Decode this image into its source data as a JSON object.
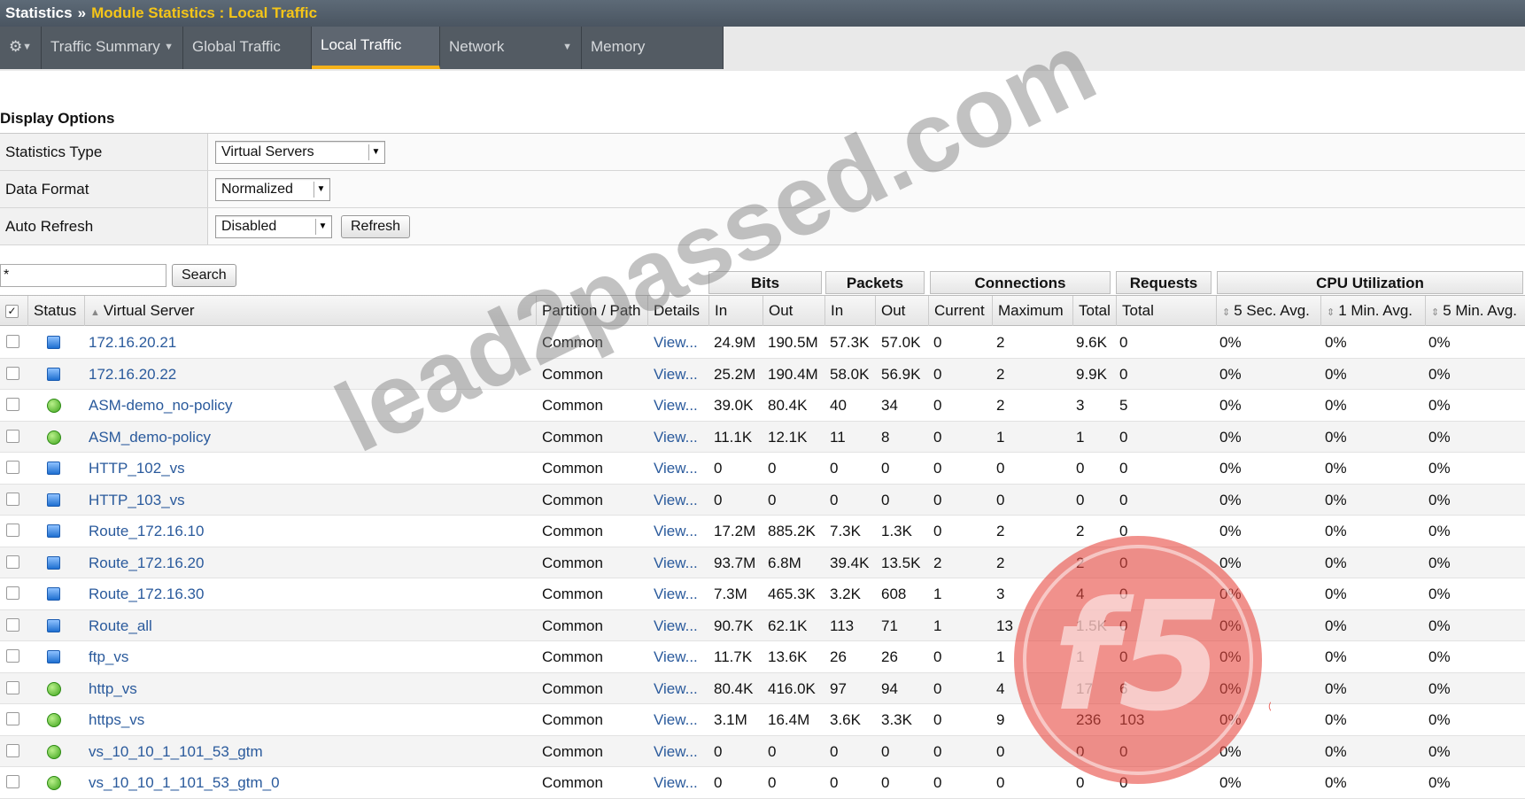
{
  "breadcrumb": {
    "root": "Statistics",
    "separator": "»",
    "current": "Module Statistics : Local Traffic"
  },
  "tabs": [
    {
      "label": "⚙",
      "has_menu": true
    },
    {
      "label": "Traffic Summary",
      "has_menu": true
    },
    {
      "label": "Global Traffic",
      "has_menu": false
    },
    {
      "label": "Local Traffic",
      "has_menu": false,
      "active": true
    },
    {
      "label": "Network",
      "has_menu": true
    },
    {
      "label": "Memory",
      "has_menu": false
    }
  ],
  "display_options": {
    "title": "Display Options",
    "statistics_type": {
      "label": "Statistics Type",
      "value": "Virtual Servers"
    },
    "data_format": {
      "label": "Data Format",
      "value": "Normalized"
    },
    "auto_refresh": {
      "label": "Auto Refresh",
      "value": "Disabled",
      "button": "Refresh"
    }
  },
  "search": {
    "value": "*",
    "button": "Search"
  },
  "groups": {
    "bits": "Bits",
    "packets": "Packets",
    "connections": "Connections",
    "requests": "Requests",
    "cpu": "CPU Utilization"
  },
  "columns": {
    "status": "Status",
    "virtual_server": "Virtual Server",
    "partition": "Partition / Path",
    "details": "Details",
    "bits_in": "In",
    "bits_out": "Out",
    "pkts_in": "In",
    "pkts_out": "Out",
    "conn_current": "Current",
    "conn_max": "Maximum",
    "conn_total": "Total",
    "req_total": "Total",
    "cpu_5s": "5 Sec. Avg.",
    "cpu_1m": "1 Min. Avg.",
    "cpu_5m": "5 Min. Avg."
  },
  "rows": [
    {
      "status": "blue",
      "name": "172.16.20.21",
      "partition": "Common",
      "details": "View...",
      "bits_in": "24.9M",
      "bits_out": "190.5M",
      "pkts_in": "57.3K",
      "pkts_out": "57.0K",
      "cur": "0",
      "max": "2",
      "total": "9.6K",
      "req": "0",
      "c5s": "0%",
      "c1m": "0%",
      "c5m": "0%"
    },
    {
      "status": "blue",
      "name": "172.16.20.22",
      "partition": "Common",
      "details": "View...",
      "bits_in": "25.2M",
      "bits_out": "190.4M",
      "pkts_in": "58.0K",
      "pkts_out": "56.9K",
      "cur": "0",
      "max": "2",
      "total": "9.9K",
      "req": "0",
      "c5s": "0%",
      "c1m": "0%",
      "c5m": "0%"
    },
    {
      "status": "green",
      "name": "ASM-demo_no-policy",
      "partition": "Common",
      "details": "View...",
      "bits_in": "39.0K",
      "bits_out": "80.4K",
      "pkts_in": "40",
      "pkts_out": "34",
      "cur": "0",
      "max": "2",
      "total": "3",
      "req": "5",
      "c5s": "0%",
      "c1m": "0%",
      "c5m": "0%"
    },
    {
      "status": "green",
      "name": "ASM_demo-policy",
      "partition": "Common",
      "details": "View...",
      "bits_in": "11.1K",
      "bits_out": "12.1K",
      "pkts_in": "11",
      "pkts_out": "8",
      "cur": "0",
      "max": "1",
      "total": "1",
      "req": "0",
      "c5s": "0%",
      "c1m": "0%",
      "c5m": "0%"
    },
    {
      "status": "blue",
      "name": "HTTP_102_vs",
      "partition": "Common",
      "details": "View...",
      "bits_in": "0",
      "bits_out": "0",
      "pkts_in": "0",
      "pkts_out": "0",
      "cur": "0",
      "max": "0",
      "total": "0",
      "req": "0",
      "c5s": "0%",
      "c1m": "0%",
      "c5m": "0%"
    },
    {
      "status": "blue",
      "name": "HTTP_103_vs",
      "partition": "Common",
      "details": "View...",
      "bits_in": "0",
      "bits_out": "0",
      "pkts_in": "0",
      "pkts_out": "0",
      "cur": "0",
      "max": "0",
      "total": "0",
      "req": "0",
      "c5s": "0%",
      "c1m": "0%",
      "c5m": "0%"
    },
    {
      "status": "blue",
      "name": "Route_172.16.10",
      "partition": "Common",
      "details": "View...",
      "bits_in": "17.2M",
      "bits_out": "885.2K",
      "pkts_in": "7.3K",
      "pkts_out": "1.3K",
      "cur": "0",
      "max": "2",
      "total": "2",
      "req": "0",
      "c5s": "0%",
      "c1m": "0%",
      "c5m": "0%"
    },
    {
      "status": "blue",
      "name": "Route_172.16.20",
      "partition": "Common",
      "details": "View...",
      "bits_in": "93.7M",
      "bits_out": "6.8M",
      "pkts_in": "39.4K",
      "pkts_out": "13.5K",
      "cur": "2",
      "max": "2",
      "total": "2",
      "req": "0",
      "c5s": "0%",
      "c1m": "0%",
      "c5m": "0%"
    },
    {
      "status": "blue",
      "name": "Route_172.16.30",
      "partition": "Common",
      "details": "View...",
      "bits_in": "7.3M",
      "bits_out": "465.3K",
      "pkts_in": "3.2K",
      "pkts_out": "608",
      "cur": "1",
      "max": "3",
      "total": "4",
      "req": "0",
      "c5s": "0%",
      "c1m": "0%",
      "c5m": "0%"
    },
    {
      "status": "blue",
      "name": "Route_all",
      "partition": "Common",
      "details": "View...",
      "bits_in": "90.7K",
      "bits_out": "62.1K",
      "pkts_in": "113",
      "pkts_out": "71",
      "cur": "1",
      "max": "13",
      "total": "1.5K",
      "req": "0",
      "c5s": "0%",
      "c1m": "0%",
      "c5m": "0%"
    },
    {
      "status": "blue",
      "name": "ftp_vs",
      "partition": "Common",
      "details": "View...",
      "bits_in": "11.7K",
      "bits_out": "13.6K",
      "pkts_in": "26",
      "pkts_out": "26",
      "cur": "0",
      "max": "1",
      "total": "1",
      "req": "0",
      "c5s": "0%",
      "c1m": "0%",
      "c5m": "0%"
    },
    {
      "status": "green",
      "name": "http_vs",
      "partition": "Common",
      "details": "View...",
      "bits_in": "80.4K",
      "bits_out": "416.0K",
      "pkts_in": "97",
      "pkts_out": "94",
      "cur": "0",
      "max": "4",
      "total": "17",
      "req": "6",
      "c5s": "0%",
      "c1m": "0%",
      "c5m": "0%"
    },
    {
      "status": "green",
      "name": "https_vs",
      "partition": "Common",
      "details": "View...",
      "bits_in": "3.1M",
      "bits_out": "16.4M",
      "pkts_in": "3.6K",
      "pkts_out": "3.3K",
      "cur": "0",
      "max": "9",
      "total": "236",
      "req": "103",
      "c5s": "0%",
      "c1m": "0%",
      "c5m": "0%"
    },
    {
      "status": "green",
      "name": "vs_10_10_1_101_53_gtm",
      "partition": "Common",
      "details": "View...",
      "bits_in": "0",
      "bits_out": "0",
      "pkts_in": "0",
      "pkts_out": "0",
      "cur": "0",
      "max": "0",
      "total": "0",
      "req": "0",
      "c5s": "0%",
      "c1m": "0%",
      "c5m": "0%"
    },
    {
      "status": "green",
      "name": "vs_10_10_1_101_53_gtm_0",
      "partition": "Common",
      "details": "View...",
      "bits_in": "0",
      "bits_out": "0",
      "pkts_in": "0",
      "pkts_out": "0",
      "cur": "0",
      "max": "0",
      "total": "0",
      "req": "0",
      "c5s": "0%",
      "c1m": "0%",
      "c5m": "0%"
    }
  ],
  "watermark": "lead2passed.com",
  "logo": {
    "text": "f5",
    "color": "#e8473f"
  }
}
